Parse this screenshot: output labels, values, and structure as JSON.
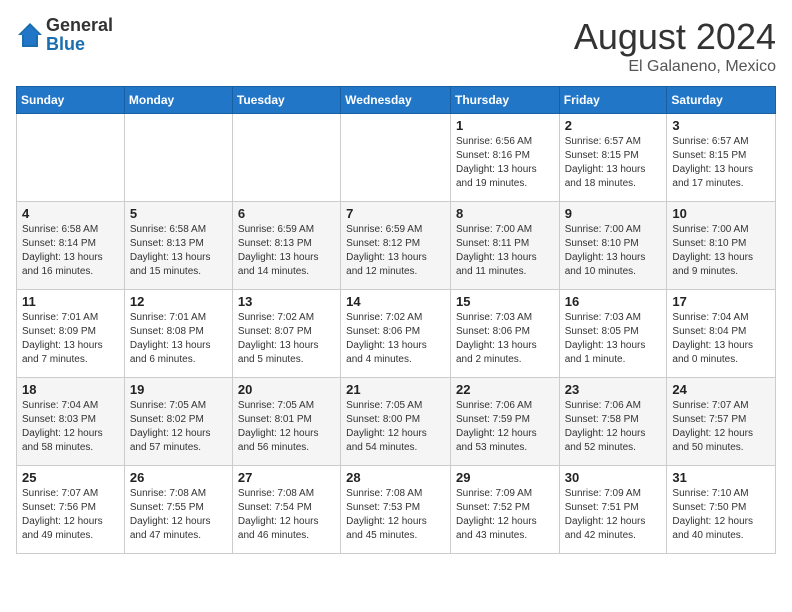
{
  "header": {
    "logo_general": "General",
    "logo_blue": "Blue",
    "month_year": "August 2024",
    "location": "El Galaneno, Mexico"
  },
  "weekdays": [
    "Sunday",
    "Monday",
    "Tuesday",
    "Wednesday",
    "Thursday",
    "Friday",
    "Saturday"
  ],
  "weeks": [
    [
      {
        "day": "",
        "info": ""
      },
      {
        "day": "",
        "info": ""
      },
      {
        "day": "",
        "info": ""
      },
      {
        "day": "",
        "info": ""
      },
      {
        "day": "1",
        "info": "Sunrise: 6:56 AM\nSunset: 8:16 PM\nDaylight: 13 hours\nand 19 minutes."
      },
      {
        "day": "2",
        "info": "Sunrise: 6:57 AM\nSunset: 8:15 PM\nDaylight: 13 hours\nand 18 minutes."
      },
      {
        "day": "3",
        "info": "Sunrise: 6:57 AM\nSunset: 8:15 PM\nDaylight: 13 hours\nand 17 minutes."
      }
    ],
    [
      {
        "day": "4",
        "info": "Sunrise: 6:58 AM\nSunset: 8:14 PM\nDaylight: 13 hours\nand 16 minutes."
      },
      {
        "day": "5",
        "info": "Sunrise: 6:58 AM\nSunset: 8:13 PM\nDaylight: 13 hours\nand 15 minutes."
      },
      {
        "day": "6",
        "info": "Sunrise: 6:59 AM\nSunset: 8:13 PM\nDaylight: 13 hours\nand 14 minutes."
      },
      {
        "day": "7",
        "info": "Sunrise: 6:59 AM\nSunset: 8:12 PM\nDaylight: 13 hours\nand 12 minutes."
      },
      {
        "day": "8",
        "info": "Sunrise: 7:00 AM\nSunset: 8:11 PM\nDaylight: 13 hours\nand 11 minutes."
      },
      {
        "day": "9",
        "info": "Sunrise: 7:00 AM\nSunset: 8:10 PM\nDaylight: 13 hours\nand 10 minutes."
      },
      {
        "day": "10",
        "info": "Sunrise: 7:00 AM\nSunset: 8:10 PM\nDaylight: 13 hours\nand 9 minutes."
      }
    ],
    [
      {
        "day": "11",
        "info": "Sunrise: 7:01 AM\nSunset: 8:09 PM\nDaylight: 13 hours\nand 7 minutes."
      },
      {
        "day": "12",
        "info": "Sunrise: 7:01 AM\nSunset: 8:08 PM\nDaylight: 13 hours\nand 6 minutes."
      },
      {
        "day": "13",
        "info": "Sunrise: 7:02 AM\nSunset: 8:07 PM\nDaylight: 13 hours\nand 5 minutes."
      },
      {
        "day": "14",
        "info": "Sunrise: 7:02 AM\nSunset: 8:06 PM\nDaylight: 13 hours\nand 4 minutes."
      },
      {
        "day": "15",
        "info": "Sunrise: 7:03 AM\nSunset: 8:06 PM\nDaylight: 13 hours\nand 2 minutes."
      },
      {
        "day": "16",
        "info": "Sunrise: 7:03 AM\nSunset: 8:05 PM\nDaylight: 13 hours\nand 1 minute."
      },
      {
        "day": "17",
        "info": "Sunrise: 7:04 AM\nSunset: 8:04 PM\nDaylight: 13 hours\nand 0 minutes."
      }
    ],
    [
      {
        "day": "18",
        "info": "Sunrise: 7:04 AM\nSunset: 8:03 PM\nDaylight: 12 hours\nand 58 minutes."
      },
      {
        "day": "19",
        "info": "Sunrise: 7:05 AM\nSunset: 8:02 PM\nDaylight: 12 hours\nand 57 minutes."
      },
      {
        "day": "20",
        "info": "Sunrise: 7:05 AM\nSunset: 8:01 PM\nDaylight: 12 hours\nand 56 minutes."
      },
      {
        "day": "21",
        "info": "Sunrise: 7:05 AM\nSunset: 8:00 PM\nDaylight: 12 hours\nand 54 minutes."
      },
      {
        "day": "22",
        "info": "Sunrise: 7:06 AM\nSunset: 7:59 PM\nDaylight: 12 hours\nand 53 minutes."
      },
      {
        "day": "23",
        "info": "Sunrise: 7:06 AM\nSunset: 7:58 PM\nDaylight: 12 hours\nand 52 minutes."
      },
      {
        "day": "24",
        "info": "Sunrise: 7:07 AM\nSunset: 7:57 PM\nDaylight: 12 hours\nand 50 minutes."
      }
    ],
    [
      {
        "day": "25",
        "info": "Sunrise: 7:07 AM\nSunset: 7:56 PM\nDaylight: 12 hours\nand 49 minutes."
      },
      {
        "day": "26",
        "info": "Sunrise: 7:08 AM\nSunset: 7:55 PM\nDaylight: 12 hours\nand 47 minutes."
      },
      {
        "day": "27",
        "info": "Sunrise: 7:08 AM\nSunset: 7:54 PM\nDaylight: 12 hours\nand 46 minutes."
      },
      {
        "day": "28",
        "info": "Sunrise: 7:08 AM\nSunset: 7:53 PM\nDaylight: 12 hours\nand 45 minutes."
      },
      {
        "day": "29",
        "info": "Sunrise: 7:09 AM\nSunset: 7:52 PM\nDaylight: 12 hours\nand 43 minutes."
      },
      {
        "day": "30",
        "info": "Sunrise: 7:09 AM\nSunset: 7:51 PM\nDaylight: 12 hours\nand 42 minutes."
      },
      {
        "day": "31",
        "info": "Sunrise: 7:10 AM\nSunset: 7:50 PM\nDaylight: 12 hours\nand 40 minutes."
      }
    ]
  ]
}
